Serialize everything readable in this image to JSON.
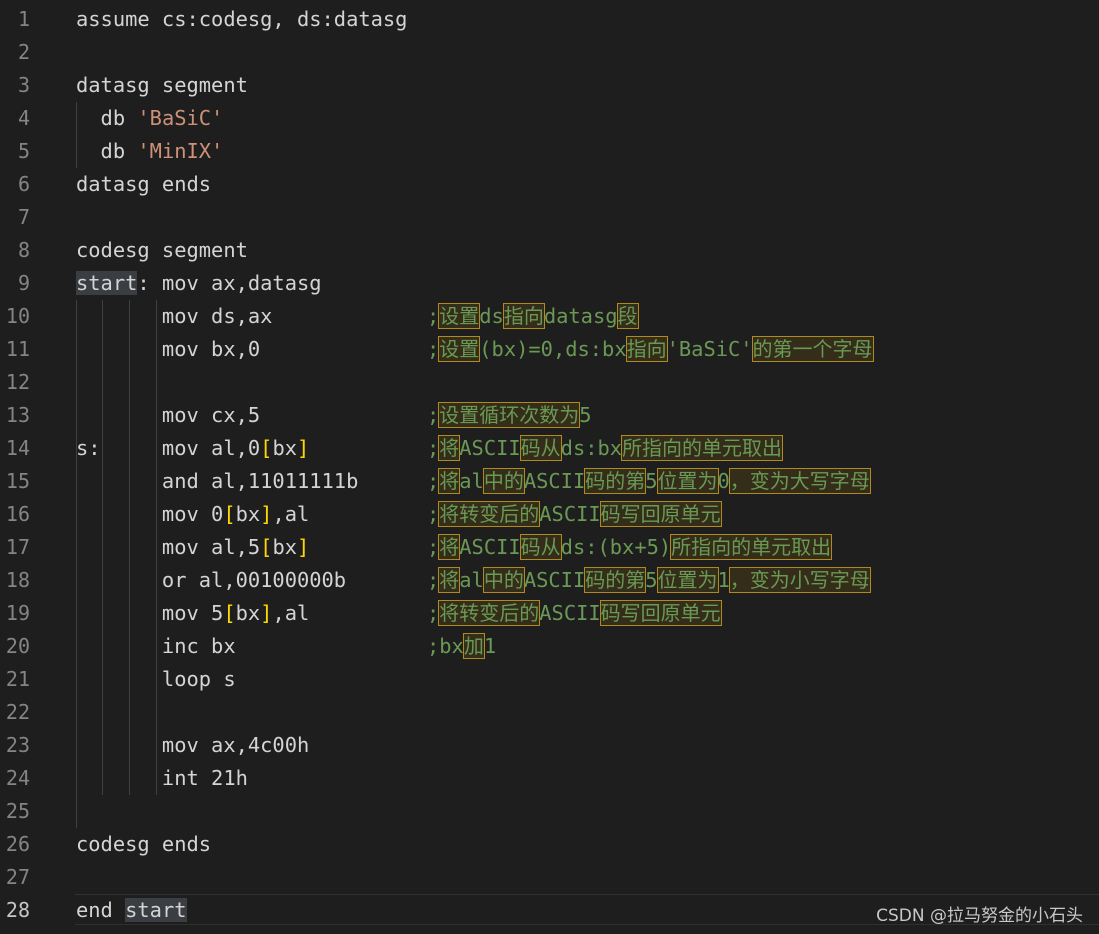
{
  "lines": [
    {
      "n": "1",
      "parts": [
        {
          "t": "assume cs:codesg, ds:datasg",
          "c": "kw"
        }
      ]
    },
    {
      "n": "2",
      "parts": []
    },
    {
      "n": "3",
      "parts": [
        {
          "t": "datasg segment",
          "c": "kw"
        }
      ]
    },
    {
      "n": "4",
      "parts": [
        {
          "t": "  db ",
          "c": "kw"
        },
        {
          "t": "'BaSiC'",
          "c": "str"
        }
      ]
    },
    {
      "n": "5",
      "parts": [
        {
          "t": "  db ",
          "c": "kw"
        },
        {
          "t": "'MinIX'",
          "c": "str"
        }
      ]
    },
    {
      "n": "6",
      "parts": [
        {
          "t": "datasg ends",
          "c": "kw"
        }
      ]
    },
    {
      "n": "7",
      "parts": []
    },
    {
      "n": "8",
      "parts": [
        {
          "t": "codesg segment",
          "c": "kw"
        }
      ]
    },
    {
      "n": "9",
      "parts": [
        {
          "t": "start",
          "c": "kw hl-sel"
        },
        {
          "t": ": mov ax,datasg",
          "c": "kw"
        }
      ]
    },
    {
      "n": "10",
      "parts": [
        {
          "t": "       mov ds,ax",
          "c": "kw"
        }
      ],
      "comment": [
        {
          "t": ";",
          "b": false
        },
        {
          "t": "设置",
          "b": true
        },
        {
          "t": "ds",
          "b": false
        },
        {
          "t": "指向",
          "b": true
        },
        {
          "t": "datasg",
          "b": false
        },
        {
          "t": "段",
          "b": true
        }
      ]
    },
    {
      "n": "11",
      "parts": [
        {
          "t": "       mov bx,0",
          "c": "kw"
        }
      ],
      "comment": [
        {
          "t": ";",
          "b": false
        },
        {
          "t": "设置",
          "b": true
        },
        {
          "t": "(bx)=0,ds:bx",
          "b": false
        },
        {
          "t": "指向",
          "b": true
        },
        {
          "t": "'BaSiC'",
          "b": false
        },
        {
          "t": "的第一个字母",
          "b": true
        }
      ]
    },
    {
      "n": "12",
      "parts": []
    },
    {
      "n": "13",
      "parts": [
        {
          "t": "       mov cx,5",
          "c": "kw"
        }
      ],
      "comment": [
        {
          "t": ";",
          "b": false
        },
        {
          "t": "设置循环次数为",
          "b": true
        },
        {
          "t": "5",
          "b": false
        }
      ]
    },
    {
      "n": "14",
      "parts": [
        {
          "t": "s:     mov al,0",
          "c": "kw"
        },
        {
          "t": "[",
          "c": "br"
        },
        {
          "t": "bx",
          "c": "kw"
        },
        {
          "t": "]",
          "c": "br"
        }
      ],
      "comment": [
        {
          "t": ";",
          "b": false
        },
        {
          "t": "将",
          "b": true
        },
        {
          "t": "ASCII",
          "b": false
        },
        {
          "t": "码从",
          "b": true
        },
        {
          "t": "ds:bx",
          "b": false
        },
        {
          "t": "所指向的单元取出",
          "b": true
        }
      ]
    },
    {
      "n": "15",
      "parts": [
        {
          "t": "       and al,11011111b",
          "c": "kw"
        }
      ],
      "comment": [
        {
          "t": ";",
          "b": false
        },
        {
          "t": "将",
          "b": true
        },
        {
          "t": "al",
          "b": false
        },
        {
          "t": "中的",
          "b": true
        },
        {
          "t": "ASCII",
          "b": false
        },
        {
          "t": "码的第",
          "b": true
        },
        {
          "t": "5",
          "b": false
        },
        {
          "t": "位置为",
          "b": true
        },
        {
          "t": "0",
          "b": false
        },
        {
          "t": "，变为大写字母",
          "b": true
        }
      ]
    },
    {
      "n": "16",
      "parts": [
        {
          "t": "       mov 0",
          "c": "kw"
        },
        {
          "t": "[",
          "c": "br"
        },
        {
          "t": "bx",
          "c": "kw"
        },
        {
          "t": "]",
          "c": "br"
        },
        {
          "t": ",al",
          "c": "kw"
        }
      ],
      "comment": [
        {
          "t": ";",
          "b": false
        },
        {
          "t": "将转变后的",
          "b": true
        },
        {
          "t": "ASCII",
          "b": false
        },
        {
          "t": "码写回原单元",
          "b": true
        }
      ]
    },
    {
      "n": "17",
      "parts": [
        {
          "t": "       mov al,5",
          "c": "kw"
        },
        {
          "t": "[",
          "c": "br"
        },
        {
          "t": "bx",
          "c": "kw"
        },
        {
          "t": "]",
          "c": "br"
        }
      ],
      "comment": [
        {
          "t": ";",
          "b": false
        },
        {
          "t": "将",
          "b": true
        },
        {
          "t": "ASCII",
          "b": false
        },
        {
          "t": "码从",
          "b": true
        },
        {
          "t": "ds:(bx+5)",
          "b": false
        },
        {
          "t": "所指向的单元取出",
          "b": true
        }
      ]
    },
    {
      "n": "18",
      "parts": [
        {
          "t": "       or al,00100000b",
          "c": "kw"
        }
      ],
      "comment": [
        {
          "t": ";",
          "b": false
        },
        {
          "t": "将",
          "b": true
        },
        {
          "t": "al",
          "b": false
        },
        {
          "t": "中的",
          "b": true
        },
        {
          "t": "ASCII",
          "b": false
        },
        {
          "t": "码的第",
          "b": true
        },
        {
          "t": "5",
          "b": false
        },
        {
          "t": "位置为",
          "b": true
        },
        {
          "t": "1",
          "b": false
        },
        {
          "t": "，变为小写字母",
          "b": true
        }
      ]
    },
    {
      "n": "19",
      "parts": [
        {
          "t": "       mov 5",
          "c": "kw"
        },
        {
          "t": "[",
          "c": "br"
        },
        {
          "t": "bx",
          "c": "kw"
        },
        {
          "t": "]",
          "c": "br"
        },
        {
          "t": ",al",
          "c": "kw"
        }
      ],
      "comment": [
        {
          "t": ";",
          "b": false
        },
        {
          "t": "将转变后的",
          "b": true
        },
        {
          "t": "ASCII",
          "b": false
        },
        {
          "t": "码写回原单元",
          "b": true
        }
      ]
    },
    {
      "n": "20",
      "parts": [
        {
          "t": "       inc bx",
          "c": "kw"
        }
      ],
      "comment": [
        {
          "t": ";bx",
          "b": false
        },
        {
          "t": "加",
          "b": true
        },
        {
          "t": "1",
          "b": false
        }
      ]
    },
    {
      "n": "21",
      "parts": [
        {
          "t": "       loop s",
          "c": "kw"
        }
      ]
    },
    {
      "n": "22",
      "parts": []
    },
    {
      "n": "23",
      "parts": [
        {
          "t": "       mov ax,4c00h",
          "c": "kw"
        }
      ]
    },
    {
      "n": "24",
      "parts": [
        {
          "t": "       int 21h",
          "c": "kw"
        }
      ]
    },
    {
      "n": "25",
      "parts": []
    },
    {
      "n": "26",
      "parts": [
        {
          "t": "codesg ends",
          "c": "kw"
        }
      ]
    },
    {
      "n": "27",
      "parts": []
    },
    {
      "n": "28",
      "parts": [
        {
          "t": "end ",
          "c": "kw"
        },
        {
          "t": "start",
          "c": "kw hl-sel"
        }
      ]
    }
  ],
  "current_line": "28",
  "watermark": "CSDN @拉马努金的小石头",
  "colors": {
    "background": "#1e1e1e",
    "text": "#d4d4d4",
    "string": "#ce9178",
    "comment": "#6a9955",
    "bracket": "#ffd700",
    "line_number": "#858585"
  }
}
